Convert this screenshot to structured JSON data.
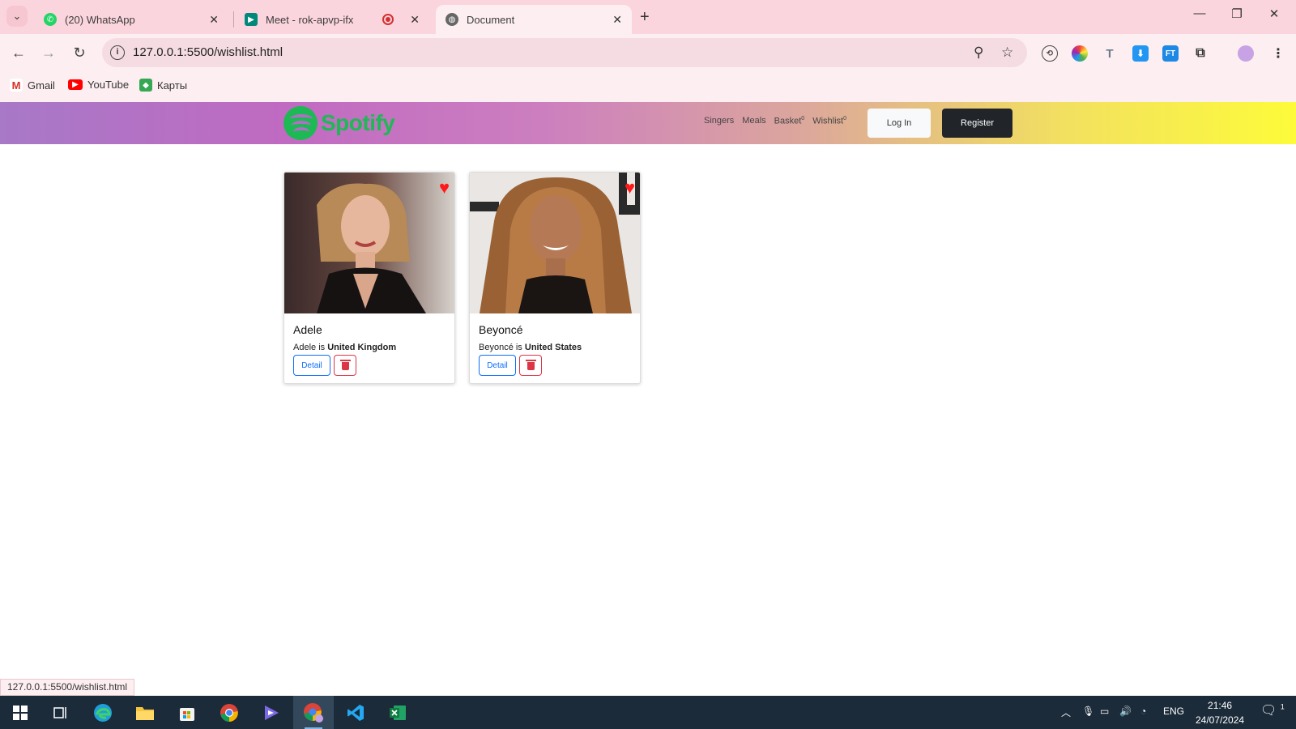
{
  "browser": {
    "tabs": [
      {
        "title": "(20) WhatsApp",
        "icon": "whatsapp-icon",
        "active": false
      },
      {
        "title": "Meet - rok-apvp-ifx",
        "icon": "google-meet-icon",
        "active": false
      },
      {
        "title": "Document",
        "icon": "globe-icon",
        "active": true
      }
    ],
    "url": "127.0.0.1:5500/wishlist.html",
    "bookmarks": [
      {
        "label": "Gmail",
        "icon": "gmail-icon"
      },
      {
        "label": "YouTube",
        "icon": "youtube-icon"
      },
      {
        "label": "Карты",
        "icon": "maps-icon"
      }
    ],
    "status_url": "127.0.0.1:5500/wishlist.html"
  },
  "site": {
    "logo_text": "Spotify",
    "nav": {
      "singers": "Singers",
      "meals": "Meals",
      "basket": "Basket",
      "basket_count": "0",
      "wishlist": "Wishlist",
      "wishlist_count": "0"
    },
    "login_label": "Log In",
    "register_label": "Register",
    "cards": [
      {
        "name": "Adele",
        "desc_prefix": "Adele is ",
        "country": "United Kingdom",
        "detail_label": "Detail"
      },
      {
        "name": "Beyoncé",
        "desc_prefix": "Beyoncé is ",
        "country": "United States",
        "detail_label": "Detail"
      }
    ]
  },
  "taskbar": {
    "language": "ENG",
    "time": "21:46",
    "date": "24/07/2024",
    "notification_count": "1"
  },
  "colors": {
    "spotify_green": "#1db954",
    "heart_red": "#ff1a1a",
    "detail_blue": "#0d6efd",
    "delete_red": "#dc3545"
  }
}
